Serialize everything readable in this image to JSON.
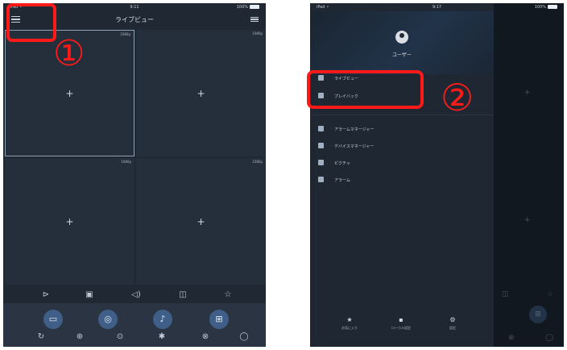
{
  "left_screen": {
    "status_bar": {
      "left": "iPad ⚬",
      "time": "9:11",
      "battery": "100%"
    },
    "nav": {
      "title": "ライブビュー",
      "menu_icon": "hamburger-menu-icon",
      "right_icon": "list-settings-icon"
    },
    "cells": [
      {
        "tag": "1080p",
        "icon": "plus-icon"
      },
      {
        "tag": "1080p",
        "icon": "plus-icon"
      },
      {
        "tag": "1080p",
        "icon": "plus-icon"
      },
      {
        "tag": "1080p",
        "icon": "plus-icon"
      }
    ],
    "toolbar_top": [
      "ptz-icon",
      "split-screen-icon",
      "audio-icon",
      "playback-icon",
      "favorite-icon"
    ],
    "action_buttons": [
      "record-icon",
      "snapshot-icon",
      "microphone-icon",
      "quality-icon"
    ],
    "toolbar_bottom": [
      "rotate-icon",
      "focus-icon",
      "zoom-icon",
      "iris-icon",
      "preset-icon",
      "cruise-icon"
    ]
  },
  "right_screen": {
    "status_bar": {
      "left": "iPad ⚬",
      "time": "9:17",
      "battery": "100%"
    },
    "user": {
      "name": "ユーザー",
      "icon": "user-avatar-icon"
    },
    "menu": [
      {
        "label": "ライブビュー",
        "icon": "live-view-icon"
      },
      {
        "label": "プレイバック",
        "icon": "playback-icon"
      },
      {
        "label": "アラームマネージャー",
        "icon": "alarm-manager-icon"
      },
      {
        "label": "デバイスマネージャー",
        "icon": "device-manager-icon"
      },
      {
        "label": "ピクチャ",
        "icon": "picture-icon"
      },
      {
        "label": "アラーム",
        "icon": "alarm-icon"
      }
    ],
    "footer": [
      {
        "label": "お気に入り",
        "icon": "star-icon"
      },
      {
        "label": "ローカル設定",
        "icon": "local-settings-icon"
      },
      {
        "label": "設定",
        "icon": "settings-icon"
      }
    ]
  },
  "annotations": {
    "step1": "①",
    "step2": "②",
    "highlight_color": "#ff1a1a"
  }
}
